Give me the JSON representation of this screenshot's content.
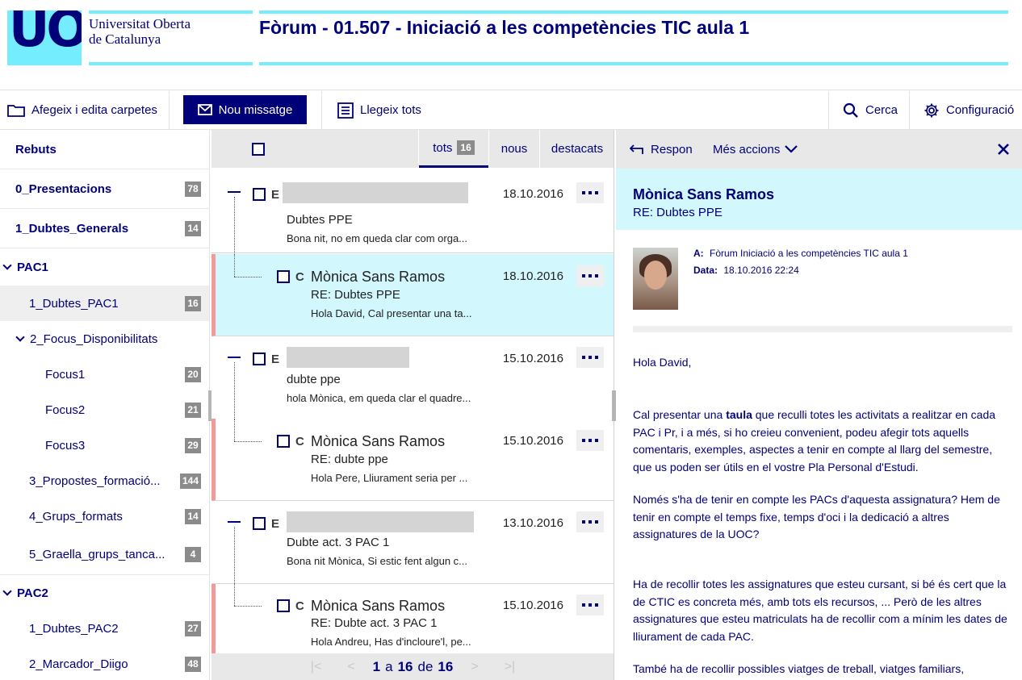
{
  "header": {
    "logo_text": "UOC",
    "uni_line1": "Universitat Oberta",
    "uni_line2": "de Catalunya",
    "title": "Fòrum - 01.507 - Iniciació a les competències TIC aula 1"
  },
  "toolbar": {
    "folders_label": "Afegeix i edita carpetes",
    "new_message_label": "Nou missatge",
    "read_all_label": "Llegeix tots",
    "search_label": "Cerca",
    "settings_label": "Configuració"
  },
  "sidebar": {
    "inbox": "Rebuts",
    "items": [
      {
        "label": "0_Presentacions",
        "count": "78"
      },
      {
        "label": "1_Dubtes_Generals",
        "count": "14"
      },
      {
        "label": "PAC1"
      },
      {
        "label": "1_Dubtes_PAC1",
        "count": "16"
      },
      {
        "label": "2_Focus_Disponibilitats"
      },
      {
        "label": "Focus1",
        "count": "20"
      },
      {
        "label": "Focus2",
        "count": "21"
      },
      {
        "label": "Focus3",
        "count": "29"
      },
      {
        "label": "3_Propostes_formació...",
        "count": "144"
      },
      {
        "label": "4_Grups_formats",
        "count": "14"
      },
      {
        "label": "5_Graella_grups_tanca...",
        "count": "4"
      },
      {
        "label": "PAC2"
      },
      {
        "label": "1_Dubtes_PAC2",
        "count": "27"
      },
      {
        "label": "2_Marcador_Diigo",
        "count": "48"
      }
    ]
  },
  "list": {
    "tabs": {
      "all": "tots",
      "all_count": "16",
      "new": "nous",
      "starred": "destacats"
    },
    "messages": [
      {
        "initial": "E",
        "sender": "",
        "date": "18.10.2016",
        "subject": "Dubtes PPE",
        "preview": "Bona nit, no em queda clar com orga..."
      },
      {
        "initial": "C",
        "sender": "Mònica Sans Ramos",
        "date": "18.10.2016",
        "subject": "RE: Dubtes PPE",
        "preview": "Hola David, Cal presentar una ta..."
      },
      {
        "initial": "E",
        "sender": "",
        "date": "15.10.2016",
        "subject": "dubte ppe",
        "preview": "hola Mònica, em queda clar el quadre..."
      },
      {
        "initial": "C",
        "sender": "Mònica Sans Ramos",
        "date": "15.10.2016",
        "subject": "RE: dubte ppe",
        "preview": "Hola Pere, Lliurament seria per ..."
      },
      {
        "initial": "E",
        "sender": "",
        "date": "13.10.2016",
        "subject": "Dubte act. 3 PAC 1",
        "preview": "Bona nit Mònica, Si estic fent algun c..."
      },
      {
        "initial": "C",
        "sender": "Mònica Sans Ramos",
        "date": "15.10.2016",
        "subject": "RE: Dubte act. 3 PAC 1",
        "preview": "Hola Andreu, Has d'incloure'l, pe..."
      }
    ],
    "pager": {
      "current": "1",
      "of_word": "a",
      "last": "16",
      "total_word": "de",
      "total": "16"
    }
  },
  "pane": {
    "reply_label": "Respon",
    "more_actions_label": "Més accions",
    "sender_name": "Mònica Sans Ramos",
    "subject": "RE: Dubtes PPE",
    "to_label": "A:",
    "to_value": "Fòrum Iniciació a les competències TIC aula 1",
    "date_label": "Data:",
    "date_value": "18.10.2016 22:24",
    "greeting": "Hola David,",
    "p1_a": "Cal presentar una ",
    "p1_bold": "taula",
    "p1_b": " que reculli totes les activitats a realitzar en cada PAC i Pr, i a més, si ho creieu convenient, podeu afegir tots aquells comentaris, exemples, aspectes a tenir en compte al llarg del semestre, que us poden ser útils en el vostre Pla Personal d'Estudi.",
    "p2": "Només s'ha de tenir en compte les PACs d'aquesta assignatura? Hem de tenir en compte el temps fixe, temps d'oci i la dedicació a altres assignatures de la UOC?",
    "p3": "Ha de recollir totes les assignatures que esteu cursant, si bé és cert que la de CTIC es concreta més, amb tots els recursos, ... Però de les altres assignatures que esteu matriculats ha de recollir com a mínim les dates de lliurament de cada PAC.",
    "p4": "També ha de recollir possibles viatges de treball, viatges familiars,"
  },
  "colors": {
    "brand_navy": "#000078",
    "brand_cyan": "#73edff",
    "selected_bg": "#d2f7fd",
    "reply_marker": "#f09a9a"
  }
}
